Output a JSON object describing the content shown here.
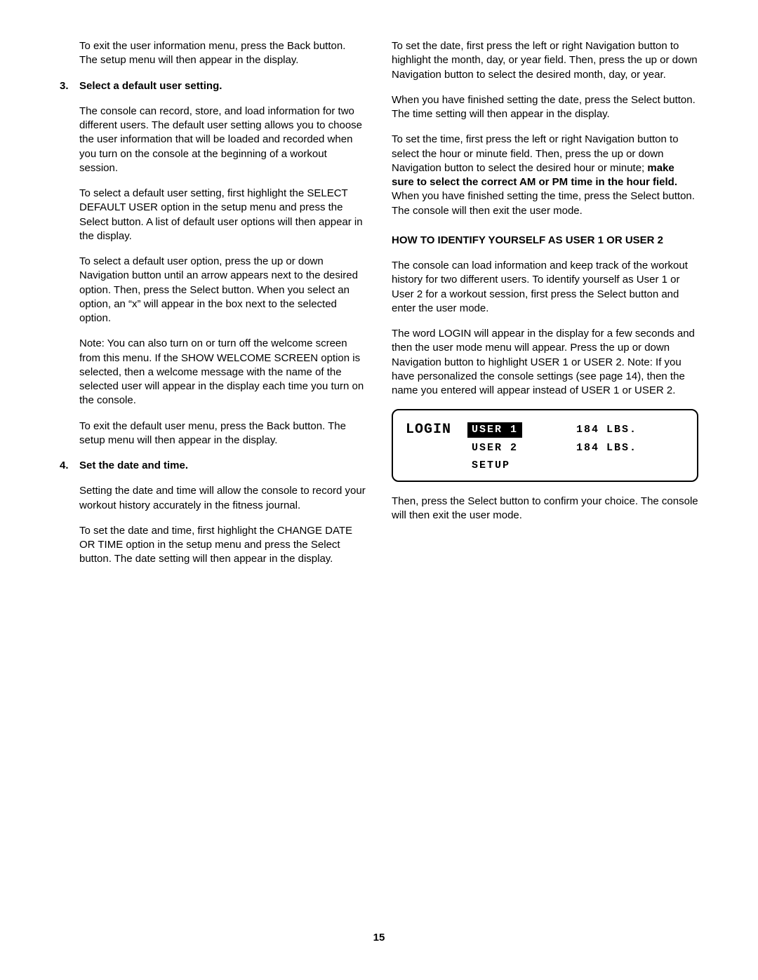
{
  "left": {
    "p1": "To exit the user information menu, press the Back button. The setup menu will then appear in the display.",
    "step3": {
      "num": "3.",
      "title": "Select a default user setting.",
      "p1": "The console can record, store, and load information for two different users. The default user setting allows you to choose the user information that will be loaded and recorded when you turn on the console at the beginning of a workout session.",
      "p2": "To select a default user setting, first highlight the SELECT DEFAULT USER option in the setup menu and press the Select button. A list of default user options will then appear in the display.",
      "p3": "To select a default user option, press the up or down Navigation button until an arrow appears next to the desired option. Then, press the Select button. When you select an option, an “x” will appear in the box next to the selected option.",
      "p4": "Note: You can also turn on or turn off the welcome screen from this menu. If the SHOW WELCOME SCREEN option is selected, then a welcome message with the name of the selected user will appear in the display each time you turn on the console.",
      "p5": "To exit the default user menu, press the Back button. The setup menu will then appear in the display."
    },
    "step4": {
      "num": "4.",
      "title": "Set the date and time.",
      "p1": "Setting the date and time will allow the console to record your workout history accurately in the fitness journal.",
      "p2": "To set the date and time, first highlight the CHANGE DATE OR TIME option in the setup menu and press the Select button. The date setting will then appear in the display."
    }
  },
  "right": {
    "p1": "To set the date, first press the left or right Navigation button to highlight the month, day, or year field. Then, press the up or down Navigation button to select the desired month, day, or year.",
    "p2": "When you have finished setting the date, press the Select button. The time setting will then appear in the display.",
    "p3a": "To set the time, first press the left or right Navigation button to select the hour or minute field. Then, press the up or down Navigation button to select the desired hour or minute; ",
    "p3b": "make sure to select the correct AM or PM time in the hour field.",
    "p3c": " When you have finished setting the time, press the Select button. The console will then exit the user mode.",
    "section_head": "HOW TO IDENTIFY YOURSELF AS USER 1 OR USER 2",
    "p4": "The console can load information and keep track of the workout history for two different users. To identify yourself as User 1 or User 2 for a workout session, first press the Select button and enter the user mode.",
    "p5": "The word LOGIN will appear in the display for a few seconds and then the user mode menu will appear. Press the up or down Navigation button to highlight USER 1 or USER 2. Note: If you have personalized the console settings (see page 14), then the name you entered will appear instead of USER 1 or USER 2.",
    "lcd": {
      "login": "LOGIN",
      "user1": "USER 1",
      "user2": "USER 2",
      "weight1": "184",
      "weight2": "184",
      "unit1": "LBS.",
      "unit2": "LBS.",
      "setup": "SETUP"
    },
    "p6": "Then, press the Select button to confirm your choice. The console will then exit the user mode."
  },
  "page_number": "15"
}
